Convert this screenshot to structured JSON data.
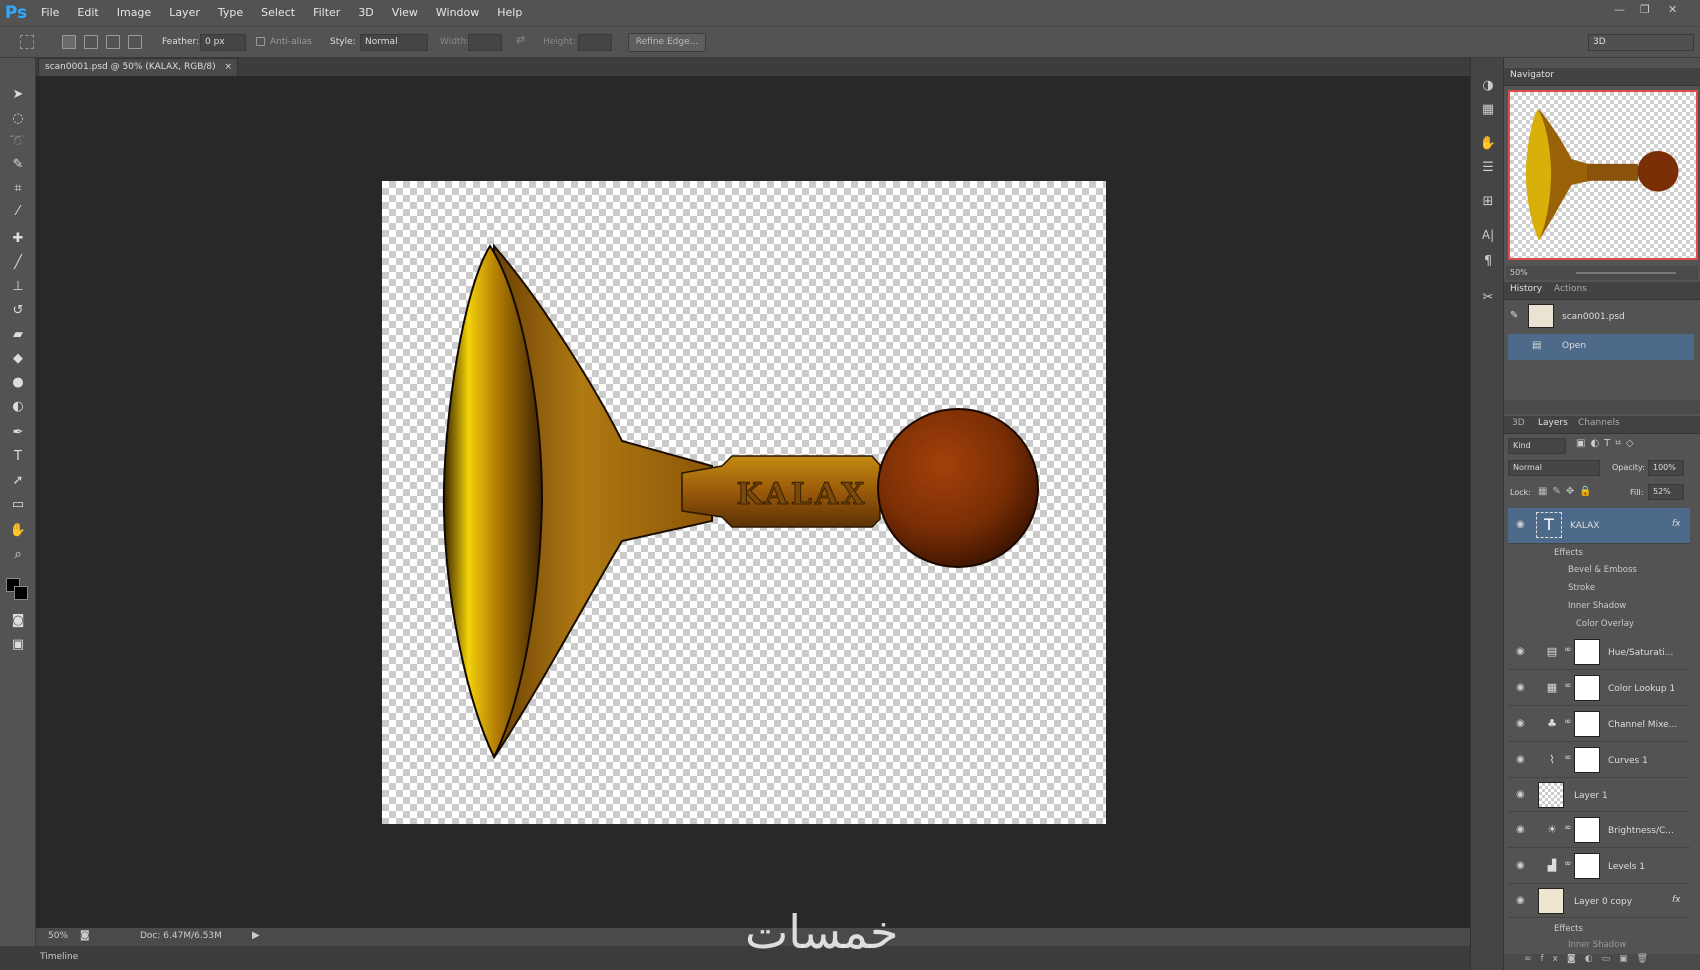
{
  "app": {
    "logo": "Ps"
  },
  "menu": [
    "File",
    "Edit",
    "Image",
    "Layer",
    "Type",
    "Select",
    "Filter",
    "3D",
    "View",
    "Window",
    "Help"
  ],
  "options": {
    "feather_label": "Feather:",
    "feather_value": "0 px",
    "antialias_label": "Anti-alias",
    "style_label": "Style:",
    "style_value": "Normal",
    "width_label": "Width:",
    "height_label": "Height:",
    "refine_label": "Refine Edge...",
    "workspace_value": "3D"
  },
  "document": {
    "tab_title": "scan0001.psd @ 50% (KALAX, RGB/8)",
    "tab_close": "×",
    "artwork_text": "KALAX"
  },
  "status": {
    "zoom": "50%",
    "doc_info": "Doc: 6.47M/6.53M"
  },
  "timeline_label": "Timeline",
  "navigator": {
    "tab": "Navigator",
    "zoom": "50%"
  },
  "history": {
    "tabs": [
      "History",
      "Actions"
    ],
    "items": [
      {
        "label": "scan0001.psd"
      },
      {
        "label": "Open"
      }
    ]
  },
  "layers": {
    "tabs": [
      "3D",
      "Layers",
      "Channels"
    ],
    "kind_label": "Kind",
    "blend_mode": "Normal",
    "opacity_label": "Opacity:",
    "opacity_value": "100%",
    "lock_label": "Lock:",
    "fill_label": "Fill:",
    "fill_value": "52%",
    "fx": "fx",
    "items": [
      {
        "name": "KALAX",
        "kind": "text"
      },
      {
        "name": "Hue/Saturati...",
        "kind": "adjustment"
      },
      {
        "name": "Color Lookup 1",
        "kind": "adjustment"
      },
      {
        "name": "Channel Mixe...",
        "kind": "adjustment"
      },
      {
        "name": "Curves 1",
        "kind": "adjustment"
      },
      {
        "name": "Layer 1",
        "kind": "pixel"
      },
      {
        "name": "Brightness/C...",
        "kind": "adjustment"
      },
      {
        "name": "Levels 1",
        "kind": "adjustment"
      },
      {
        "name": "Layer 0 copy",
        "kind": "pixel"
      }
    ],
    "effects_label": "Effects",
    "effects": [
      "Bevel & Emboss",
      "Stroke",
      "Inner Shadow",
      "Color Overlay"
    ],
    "effects2_label": "Effects",
    "effects2_partial": "Inner Shadow"
  },
  "watermark": "خمسات"
}
